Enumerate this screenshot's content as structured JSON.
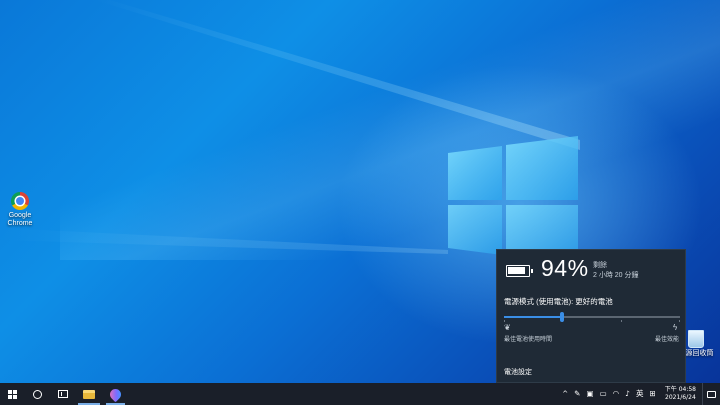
{
  "desktop": {
    "icons": [
      {
        "label": "Google Chrome",
        "icon": "chrome-icon"
      },
      {
        "label": "資源回收筒",
        "icon": "recycle-bin-icon"
      }
    ]
  },
  "battery_flyout": {
    "battery_percent": "94%",
    "remaining_label": "剩餘",
    "remaining_time": "2 小時 20 分鐘",
    "power_mode_title": "電源模式 (使用電池): 更好的電池",
    "slider_position": 0.32,
    "slider_accent": "#3a8ee6",
    "left_end_label": "最佳電池使用時間",
    "right_end_label": "最佳效能",
    "settings_link": "電池設定"
  },
  "taskbar": {
    "pinned": [
      "start-icon",
      "cortana-icon",
      "task-view-icon",
      "file-explorer-icon",
      "app-icon"
    ],
    "tray": {
      "chevron": "^",
      "input_language": "英",
      "clock_period": "下午 04:58",
      "clock_date": "2021/6/24"
    }
  }
}
